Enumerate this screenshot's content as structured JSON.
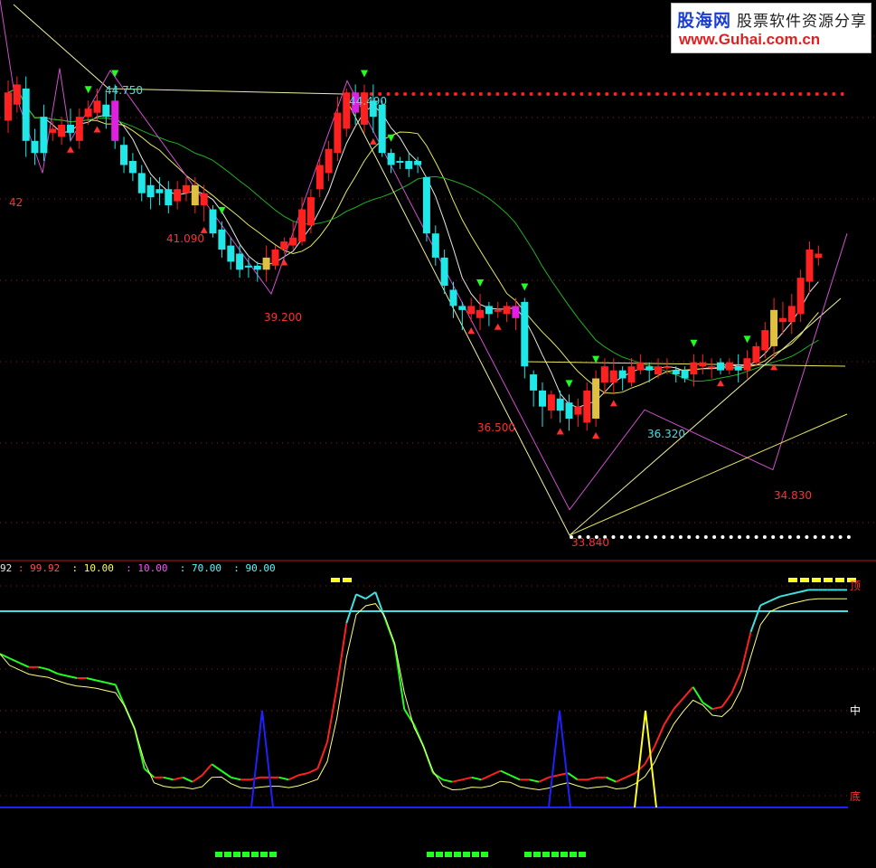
{
  "watermark": {
    "brand": "股海网",
    "tagline": "股票软件资源分享",
    "url": "www.Guhai.com.cn"
  },
  "indicator_header": [
    {
      "text": "92",
      "color": "#e9e9e9"
    },
    {
      "text": " : 99.92",
      "color": "#ff5050"
    },
    {
      "text": "  : 10.00",
      "color": "#ffff50"
    },
    {
      "text": "  : 10.00",
      "color": "#ff50ff"
    },
    {
      "text": "  : 70.00",
      "color": "#50ffff"
    },
    {
      "text": "  : 90.00",
      "color": "#50ffff"
    }
  ],
  "chart_data": [
    {
      "type": "candlestick",
      "price_labels": [
        "42",
        "44.750",
        "41.090",
        "39.200",
        "44.490",
        "36.500",
        "33.840",
        "36.320",
        "34.830"
      ],
      "candles": [
        [
          "up",
          43.5,
          44.2,
          43.2,
          44.5
        ],
        [
          "up",
          43.9,
          44.4,
          43.7,
          44.6
        ],
        [
          "down",
          44.3,
          43.0,
          42.6,
          44.6
        ],
        [
          "down",
          43.0,
          42.7,
          42.4,
          43.3
        ],
        [
          "down",
          42.7,
          43.6,
          42.5,
          43.9
        ],
        [
          "up",
          43.2,
          43.3,
          43.0,
          43.5
        ],
        [
          "up",
          43.1,
          43.4,
          42.9,
          43.6
        ],
        [
          "down",
          43.4,
          43.2,
          43.0,
          43.8
        ],
        [
          "up",
          43.0,
          43.6,
          42.8,
          43.8
        ],
        [
          "up",
          43.6,
          43.8,
          43.4,
          44.0
        ],
        [
          "up",
          43.7,
          44.0,
          43.5,
          44.3
        ],
        [
          "down",
          43.9,
          43.6,
          43.3,
          44.2
        ],
        [
          "down",
          44.0,
          43.0,
          42.8,
          44.4
        ],
        [
          "down",
          42.9,
          42.4,
          42.2,
          43.1
        ],
        [
          "down",
          42.5,
          42.2,
          42.0,
          42.7
        ],
        [
          "down",
          42.2,
          41.7,
          41.5,
          42.4
        ],
        [
          "down",
          41.9,
          41.6,
          41.3,
          42.1
        ],
        [
          "down",
          41.7,
          41.8,
          41.4,
          42.1
        ],
        [
          "down",
          41.8,
          41.4,
          41.2,
          42.0
        ],
        [
          "up",
          41.5,
          41.8,
          41.3,
          42.0
        ],
        [
          "up",
          41.7,
          41.9,
          41.5,
          42.1
        ],
        [
          "up",
          41.4,
          41.9,
          41.2,
          42.1
        ],
        [
          "up",
          41.7,
          41.4,
          41.0,
          41.9
        ],
        [
          "down",
          41.3,
          40.7,
          40.6,
          41.4
        ],
        [
          "down",
          40.8,
          40.3,
          40.1,
          41.0
        ],
        [
          "down",
          40.4,
          40.0,
          39.8,
          40.6
        ],
        [
          "down",
          40.2,
          39.8,
          39.6,
          40.4
        ],
        [
          "down",
          39.9,
          39.9,
          39.6,
          40.1
        ],
        [
          "down",
          39.9,
          39.8,
          39.5,
          40.0
        ],
        [
          "up",
          39.8,
          40.1,
          39.5,
          40.4
        ],
        [
          "up",
          39.9,
          40.3,
          39.8,
          40.4
        ],
        [
          "up",
          40.3,
          40.5,
          40.2,
          40.6
        ],
        [
          "up",
          40.4,
          40.6,
          40.3,
          41.0
        ],
        [
          "up",
          40.5,
          41.3,
          40.4,
          41.6
        ],
        [
          "up",
          40.9,
          41.6,
          40.7,
          41.8
        ],
        [
          "up",
          41.8,
          42.4,
          41.6,
          42.6
        ],
        [
          "up",
          42.2,
          42.8,
          42.0,
          43.0
        ],
        [
          "up",
          42.7,
          43.7,
          42.5,
          44.1
        ],
        [
          "up",
          43.3,
          44.2,
          43.1,
          44.3
        ],
        [
          "down",
          44.2,
          43.7,
          43.4,
          44.4
        ],
        [
          "up",
          43.4,
          44.2,
          43.2,
          44.4
        ],
        [
          "down",
          44.0,
          43.6,
          43.2,
          44.4
        ],
        [
          "down",
          43.9,
          42.7,
          42.6,
          44.0
        ],
        [
          "down",
          42.7,
          42.4,
          42.2,
          42.8
        ],
        [
          "down",
          42.5,
          42.5,
          42.3,
          42.6
        ],
        [
          "down",
          42.5,
          42.3,
          42.1,
          42.7
        ],
        [
          "down",
          42.4,
          42.5,
          42.2,
          42.6
        ],
        [
          "down",
          42.1,
          40.7,
          40.5,
          42.1
        ],
        [
          "down",
          40.7,
          40.1,
          39.9,
          40.9
        ],
        [
          "down",
          40.1,
          39.4,
          39.2,
          40.3
        ],
        [
          "down",
          39.3,
          38.9,
          38.6,
          39.5
        ],
        [
          "down",
          38.8,
          38.9,
          38.3,
          39.0
        ],
        [
          "up",
          38.9,
          38.7,
          38.5,
          39.1
        ],
        [
          "up",
          38.6,
          38.8,
          38.3,
          39.2
        ],
        [
          "down",
          38.7,
          38.9,
          38.4,
          39.0
        ],
        [
          "up",
          38.8,
          38.8,
          38.6,
          39.0
        ],
        [
          "up",
          38.7,
          38.9,
          38.5,
          39.0
        ],
        [
          "up",
          38.6,
          38.9,
          38.3,
          39.1
        ],
        [
          "down",
          39.0,
          37.4,
          37.1,
          39.1
        ],
        [
          "down",
          37.2,
          36.8,
          36.4,
          37.3
        ],
        [
          "down",
          36.8,
          36.4,
          35.9,
          37.0
        ],
        [
          "up",
          36.3,
          36.7,
          36.1,
          36.8
        ],
        [
          "down",
          36.6,
          36.3,
          36.0,
          36.8
        ],
        [
          "down",
          36.5,
          36.1,
          35.8,
          36.7
        ],
        [
          "up",
          36.2,
          36.4,
          35.9,
          36.6
        ],
        [
          "up",
          36.0,
          36.8,
          35.8,
          37.0
        ],
        [
          "up",
          36.1,
          37.1,
          35.9,
          37.3
        ],
        [
          "up",
          37.0,
          37.4,
          36.7,
          37.6
        ],
        [
          "up",
          37.0,
          37.3,
          36.7,
          37.6
        ],
        [
          "down",
          37.3,
          37.1,
          36.8,
          37.4
        ],
        [
          "up",
          37.0,
          37.4,
          36.9,
          37.6
        ],
        [
          "up",
          37.3,
          37.5,
          37.2,
          37.7
        ],
        [
          "down",
          37.4,
          37.3,
          37.0,
          37.5
        ],
        [
          "up",
          37.2,
          37.4,
          37.1,
          37.6
        ],
        [
          "up",
          37.4,
          37.4,
          37.2,
          37.6
        ],
        [
          "down",
          37.3,
          37.2,
          37.0,
          37.4
        ],
        [
          "down",
          37.3,
          37.1,
          37.0,
          37.4
        ],
        [
          "up",
          37.2,
          37.5,
          36.9,
          37.7
        ],
        [
          "up",
          37.4,
          37.5,
          37.2,
          37.7
        ],
        [
          "up",
          37.4,
          37.4,
          37.1,
          37.6
        ],
        [
          "down",
          37.5,
          37.3,
          37.2,
          37.6
        ],
        [
          "up",
          37.3,
          37.5,
          37.2,
          37.6
        ],
        [
          "down",
          37.4,
          37.3,
          37.0,
          37.7
        ],
        [
          "up",
          37.3,
          37.6,
          37.1,
          37.8
        ],
        [
          "up",
          37.5,
          37.9,
          37.4,
          38.0
        ],
        [
          "up",
          37.8,
          38.3,
          37.6,
          38.5
        ],
        [
          "up",
          37.9,
          38.8,
          37.6,
          39.1
        ],
        [
          "up",
          38.5,
          38.6,
          38.2,
          39.0
        ],
        [
          "up",
          38.5,
          38.9,
          38.2,
          39.2
        ],
        [
          "up",
          38.7,
          39.6,
          38.5,
          39.8
        ],
        [
          "up",
          39.5,
          40.3,
          39.2,
          40.5
        ],
        [
          "up",
          40.2,
          40.1,
          39.9,
          40.4
        ]
      ]
    },
    {
      "type": "line",
      "labels": [
        "顶",
        "中",
        "底"
      ],
      "series": [
        {
          "color": "#00ff00",
          "values": [
            70,
            68,
            66,
            64,
            64,
            63,
            61,
            60,
            59,
            59,
            58,
            57,
            56,
            46,
            36,
            18,
            14,
            14,
            13,
            14,
            12,
            15,
            20,
            17,
            14,
            13,
            13,
            14,
            14,
            14,
            13,
            15,
            16,
            18,
            30,
            55,
            84,
            97,
            95,
            98,
            86,
            74,
            45,
            38,
            28,
            16,
            13,
            12,
            13,
            14,
            13,
            15,
            17,
            15,
            13,
            13,
            12,
            14,
            15,
            16,
            13,
            13,
            14,
            14,
            12,
            14,
            16,
            20,
            28,
            38,
            45,
            50,
            55,
            48,
            45,
            46,
            52,
            62,
            80,
            92,
            94,
            96,
            97,
            98,
            99,
            99,
            99,
            99,
            99
          ]
        }
      ]
    }
  ]
}
